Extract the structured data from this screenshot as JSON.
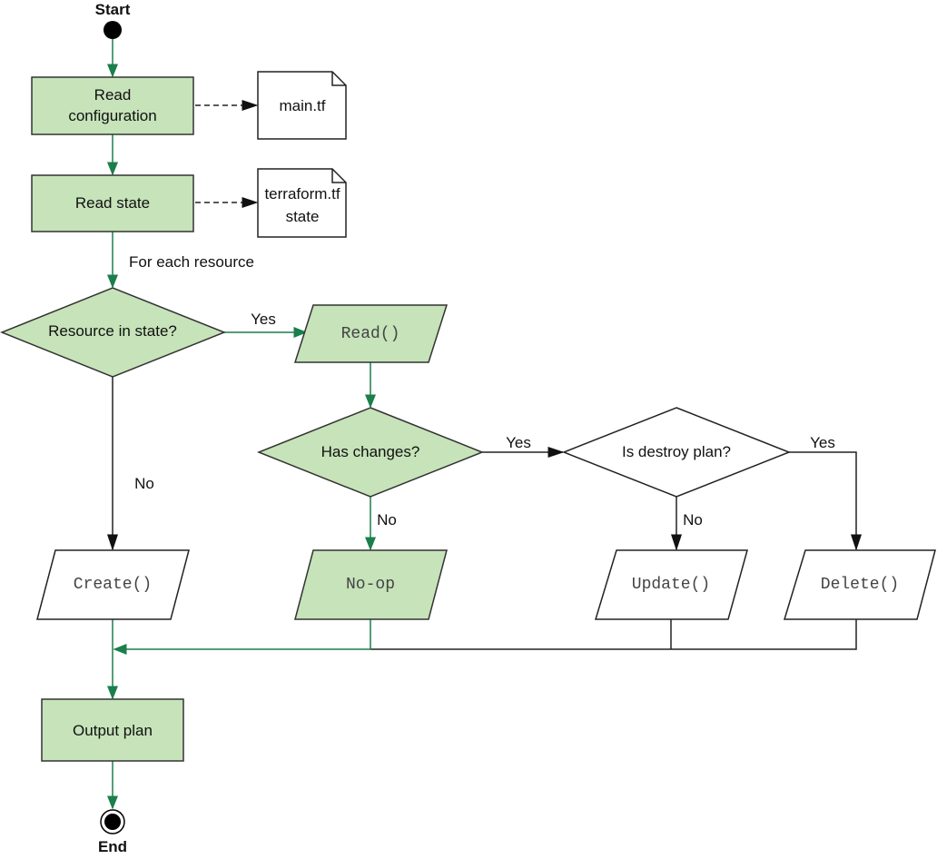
{
  "start_label": "Start",
  "end_label": "End",
  "nodes": {
    "read_config": [
      "Read",
      "configuration"
    ],
    "main_tf": "main.tf",
    "read_state": "Read state",
    "state_file": [
      "terraform.tf",
      "state"
    ],
    "for_each": "For each resource",
    "resource_in_state": "Resource in state?",
    "read_fn": "Read()",
    "has_changes": "Has changes?",
    "is_destroy": "Is destroy plan?",
    "create_fn": "Create()",
    "noop": "No-op",
    "update_fn": "Update()",
    "delete_fn": "Delete()",
    "output_plan": "Output plan"
  },
  "edge_labels": {
    "yes1": "Yes",
    "no1": "No",
    "yes2": "Yes",
    "no2": "No",
    "yes3": "Yes",
    "no3": "No"
  },
  "colors": {
    "highlight_fill": "#c6e3b9",
    "flow_green": "#1a7f4b"
  }
}
